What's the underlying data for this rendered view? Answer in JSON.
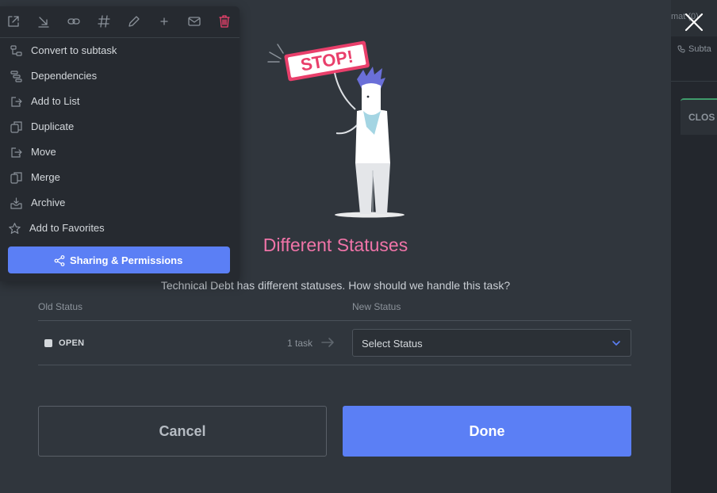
{
  "background": {
    "top_fragment": "mat (0)",
    "subtasks_label": "Subta",
    "column_label": "CLOS"
  },
  "modal": {
    "title": "Different Statuses",
    "description": "Technical Debt has different statuses. How should we handle this task?",
    "headers": {
      "old": "Old Status",
      "new": "New Status"
    },
    "mapping": [
      {
        "old_status": "OPEN",
        "old_color": "#d4d8dc",
        "count": "1 task",
        "select_placeholder": "Select Status"
      }
    ],
    "cancel_label": "Cancel",
    "done_label": "Done",
    "illustration_text": "STOP!"
  },
  "menu": {
    "toolbar": [
      "external-link-icon",
      "download-icon",
      "link-icon",
      "hash-icon",
      "pencil-icon",
      "plus-icon",
      "mail-icon",
      "trash-icon"
    ],
    "items": [
      {
        "label": "Convert to subtask",
        "icon": "subtask-icon"
      },
      {
        "label": "Dependencies",
        "icon": "dependencies-icon"
      },
      {
        "label": "Add to List",
        "icon": "add-to-list-icon"
      },
      {
        "label": "Duplicate",
        "icon": "duplicate-icon"
      },
      {
        "label": "Move",
        "icon": "move-icon"
      },
      {
        "label": "Merge",
        "icon": "merge-icon"
      },
      {
        "label": "Archive",
        "icon": "archive-icon"
      },
      {
        "label": "Add to Favorites",
        "icon": "star-icon"
      }
    ],
    "share_label": "Sharing & Permissions"
  },
  "colors": {
    "accent": "#5b7ff5",
    "title_pink": "#f074a8",
    "danger": "#f0426e",
    "modal_bg": "#30363d",
    "menu_bg": "#262a30"
  }
}
